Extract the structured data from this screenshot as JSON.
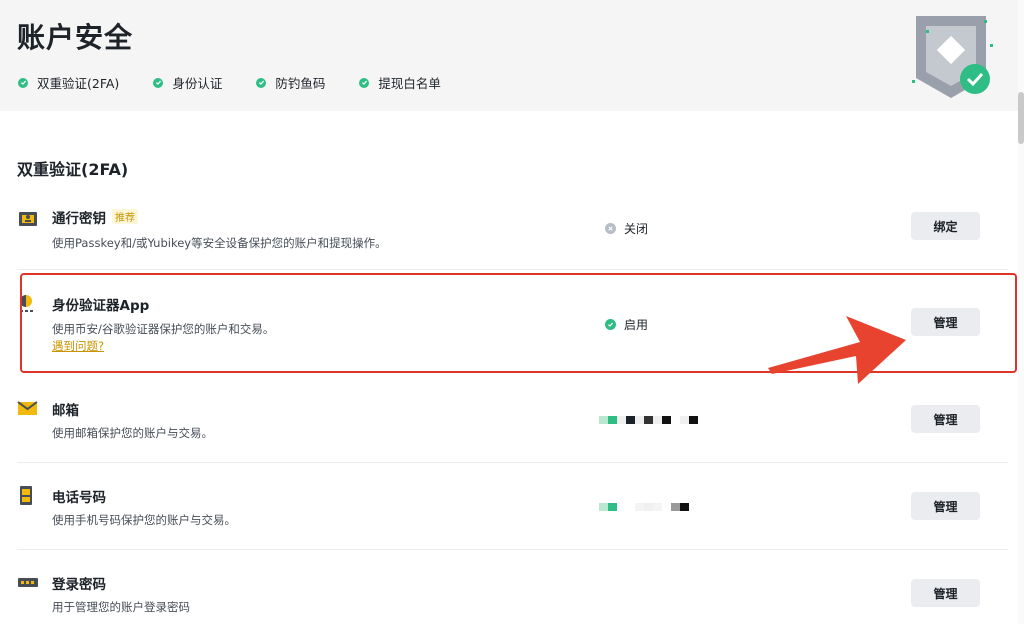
{
  "header": {
    "title": "账户安全",
    "status_items": [
      {
        "label": "双重验证(2FA)",
        "icon": "check-circle-icon"
      },
      {
        "label": "身份认证",
        "icon": "check-circle-icon"
      },
      {
        "label": "防钓鱼码",
        "icon": "check-circle-icon"
      },
      {
        "label": "提现白名单",
        "icon": "check-circle-icon"
      }
    ]
  },
  "section": {
    "title": "双重验证(2FA)"
  },
  "rows": [
    {
      "name": "通行密钥",
      "tag": "推荐",
      "desc": "使用Passkey和/或Yubikey等安全设备保护您的账户和提现操作。",
      "status": "关闭",
      "button": "绑定",
      "icon": "passkey-icon"
    },
    {
      "name": "身份验证器App",
      "desc": "使用币安/谷歌验证器保护您的账户和交易。",
      "link": "遇到问题?",
      "status": "启用",
      "button": "管理",
      "icon": "authenticator-icon"
    },
    {
      "name": "邮箱",
      "desc": "使用邮箱保护您的账户与交易。",
      "button": "管理",
      "icon": "mail-icon"
    },
    {
      "name": "电话号码",
      "desc": "使用手机号码保护您的账户与交易。",
      "button": "管理",
      "icon": "phone-icon"
    },
    {
      "name": "登录密码",
      "desc": "用于管理您的账户登录密码",
      "button": "管理",
      "icon": "password-icon"
    }
  ],
  "colors": {
    "success": "#2ebd85",
    "brand": "#f0b90b",
    "highlight": "#e0342a",
    "muted": "#b7bdc6"
  }
}
